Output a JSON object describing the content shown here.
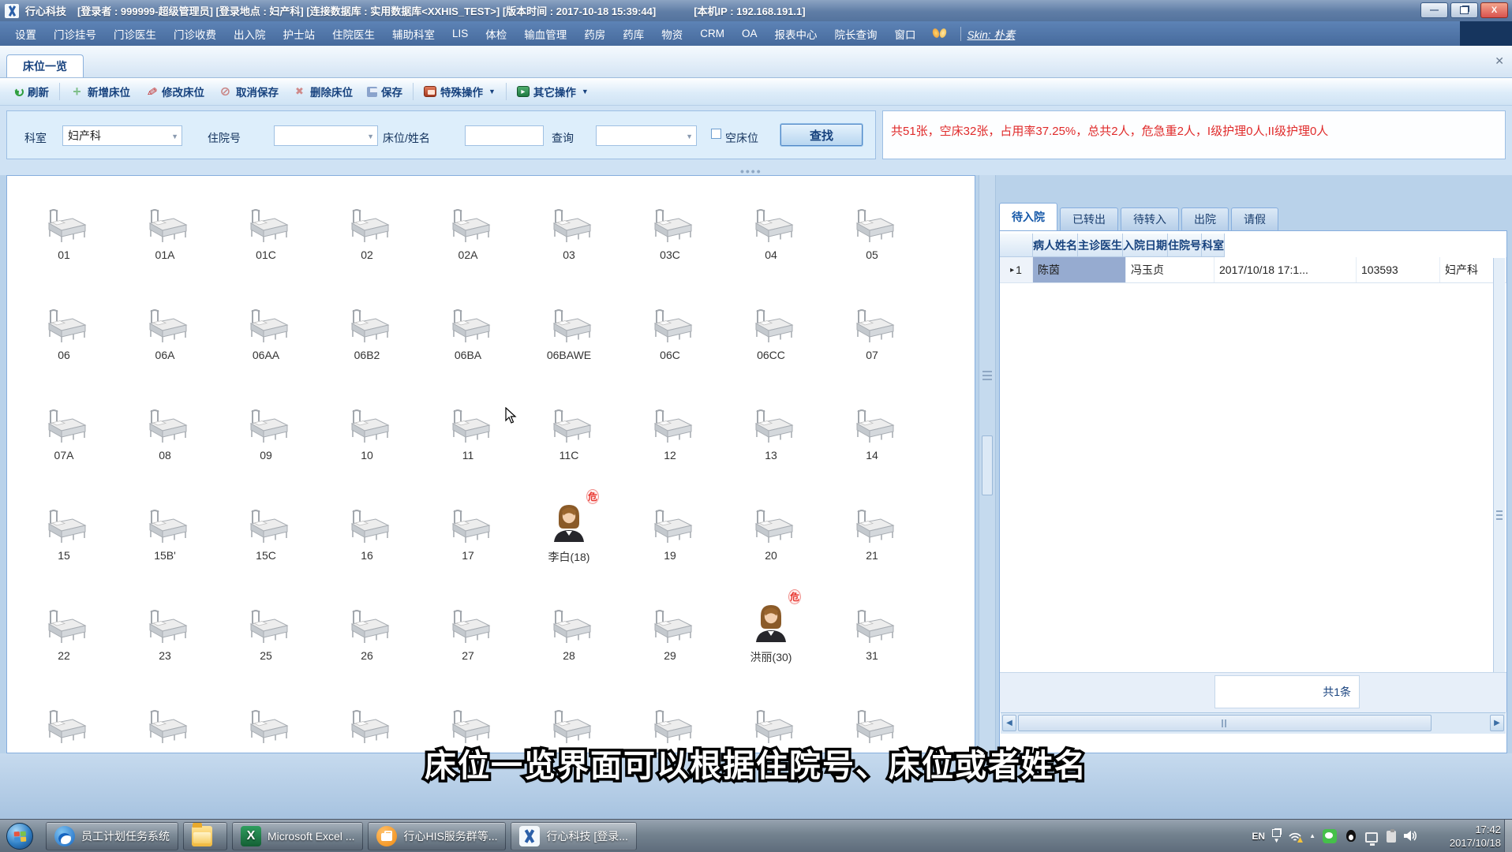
{
  "title_bar": {
    "app_name": "行心科技",
    "session_info": "[登录者 : 999999-超级管理员]  [登录地点 : 妇产科]  [连接数据库 : 实用数据库<XXHIS_TEST>]  [版本时间 : 2017-10-18 15:39:44]",
    "ip_info": "[本机IP : 192.168.191.1]"
  },
  "menu": {
    "items": [
      {
        "label": "设置"
      },
      {
        "label": "门诊挂号"
      },
      {
        "label": "门诊医生"
      },
      {
        "label": "门诊收费"
      },
      {
        "label": "出入院"
      },
      {
        "label": "护士站"
      },
      {
        "label": "住院医生"
      },
      {
        "label": "辅助科室"
      },
      {
        "label": "LIS"
      },
      {
        "label": "体检"
      },
      {
        "label": "输血管理"
      },
      {
        "label": "药房"
      },
      {
        "label": "药库"
      },
      {
        "label": "物资"
      },
      {
        "label": "CRM"
      },
      {
        "label": "OA"
      },
      {
        "label": "报表中心"
      },
      {
        "label": "院长查询"
      },
      {
        "label": "窗口"
      }
    ],
    "skin_label": "Skin: 朴素"
  },
  "page_tab": {
    "label": "床位一览",
    "close_glyph": "✕"
  },
  "toolbar": {
    "buttons": [
      {
        "label": "刷新",
        "icon": "refresh-icon",
        "enabled": true,
        "sep_after": true
      },
      {
        "label": "新增床位",
        "icon": "add-icon",
        "enabled": false
      },
      {
        "label": "修改床位",
        "icon": "edit-icon",
        "enabled": true
      },
      {
        "label": "取消保存",
        "icon": "cancel-icon",
        "enabled": false
      },
      {
        "label": "删除床位",
        "icon": "delete-icon",
        "enabled": false
      },
      {
        "label": "保存",
        "icon": "save-icon",
        "enabled": false,
        "sep_after": true
      },
      {
        "label": "特殊操作",
        "icon": "special-icon",
        "enabled": true,
        "dropdown": true,
        "sep_after": true
      },
      {
        "label": "其它操作",
        "icon": "other-icon",
        "enabled": true,
        "dropdown": true
      }
    ]
  },
  "filters": {
    "dept_label": "科室",
    "dept_value": "妇产科",
    "admission_label": "住院号",
    "admission_value": "",
    "bed_name_label": "床位/姓名",
    "bed_name_value": "",
    "query_label": "查询",
    "query_value": "",
    "empty_bed_label": "空床位",
    "search_button": "查找",
    "stats": "共51张，空床32张，占用率37.25%，总共2人，危急重2人，I级护理0人,II级护理0人"
  },
  "beds": [
    {
      "label": "01"
    },
    {
      "label": "01A"
    },
    {
      "label": "01C"
    },
    {
      "label": "02"
    },
    {
      "label": "02A"
    },
    {
      "label": "03"
    },
    {
      "label": "03C"
    },
    {
      "label": "04"
    },
    {
      "label": "05"
    },
    {
      "label": "06"
    },
    {
      "label": "06A"
    },
    {
      "label": "06AA"
    },
    {
      "label": "06B2"
    },
    {
      "label": "06BA"
    },
    {
      "label": "06BAWE"
    },
    {
      "label": "06C"
    },
    {
      "label": "06CC"
    },
    {
      "label": "07"
    },
    {
      "label": "07A"
    },
    {
      "label": "08"
    },
    {
      "label": "09"
    },
    {
      "label": "10"
    },
    {
      "label": "11"
    },
    {
      "label": "11C"
    },
    {
      "label": "12"
    },
    {
      "label": "13"
    },
    {
      "label": "14"
    },
    {
      "label": "15"
    },
    {
      "label": "15B'"
    },
    {
      "label": "15C"
    },
    {
      "label": "16"
    },
    {
      "label": "17"
    },
    {
      "label": "李白(18)",
      "patient": true,
      "flag": "危"
    },
    {
      "label": "19"
    },
    {
      "label": "20"
    },
    {
      "label": "21"
    },
    {
      "label": "22"
    },
    {
      "label": "23"
    },
    {
      "label": "25"
    },
    {
      "label": "26"
    },
    {
      "label": "27"
    },
    {
      "label": "28"
    },
    {
      "label": "29"
    },
    {
      "label": "洪丽(30)",
      "patient": true,
      "flag": "危"
    },
    {
      "label": "31"
    },
    {
      "label": ""
    },
    {
      "label": ""
    },
    {
      "label": ""
    },
    {
      "label": ""
    },
    {
      "label": ""
    },
    {
      "label": ""
    },
    {
      "label": ""
    },
    {
      "label": ""
    },
    {
      "label": ""
    }
  ],
  "right_panel": {
    "tabs": [
      {
        "label": "待入院",
        "active": true
      },
      {
        "label": "已转出"
      },
      {
        "label": "待转入"
      },
      {
        "label": "出院"
      },
      {
        "label": "请假"
      }
    ],
    "columns": [
      {
        "label": "病人姓名"
      },
      {
        "label": "主诊医生"
      },
      {
        "label": "入院日期"
      },
      {
        "label": "住院号"
      },
      {
        "label": "科室"
      }
    ],
    "row": {
      "indicator": "1",
      "patient_name": "陈茵",
      "doctor": "冯玉贞",
      "admit_date": "2017/10/18 17:1...",
      "admission_no": "103593",
      "dept": "妇产科"
    },
    "summary": "共1条"
  },
  "subtitle": "床位一览界面可以根据住院号、床位或者姓名",
  "taskbar": {
    "buttons": [
      {
        "label": "员工计划任务系统",
        "icon": "qq-browser-icon"
      },
      {
        "label": "",
        "icon": "folder-icon"
      },
      {
        "label": "Microsoft Excel ...",
        "icon": "excel-icon"
      },
      {
        "label": "行心HIS服务群等...",
        "icon": "his-chat-icon"
      },
      {
        "label": "行心科技  [登录...",
        "icon": "xingxin-icon",
        "active": true
      }
    ],
    "tray": {
      "lang": "EN",
      "time": "17:42",
      "date": "2017/10/18"
    }
  }
}
